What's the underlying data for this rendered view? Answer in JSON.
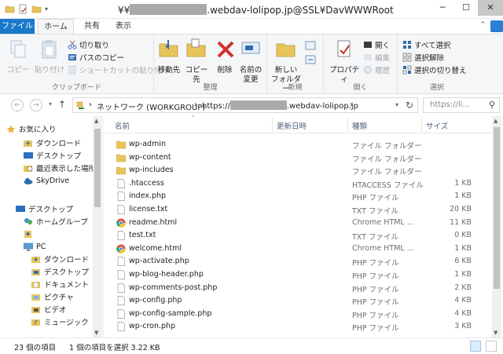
{
  "window": {
    "title_prefix": "¥¥",
    "title_suffix": ".webdav-lolipop.jp@SSL¥DavWWWRoot",
    "controls": {
      "minimize": "─",
      "maximize": "☐",
      "close": "✕"
    }
  },
  "ribbon_tabs": {
    "file": "ファイル",
    "home": "ホーム",
    "share": "共有",
    "view": "表示"
  },
  "ribbon": {
    "clipboard": {
      "label": "クリップボード",
      "copy": "コピー",
      "paste": "貼り付け",
      "cut": "切り取り",
      "copy_path": "パスのコピー",
      "paste_shortcut": "ショートカットの貼り付け"
    },
    "organize": {
      "label": "整理",
      "move_to": "移動先",
      "copy_to": "コピー先",
      "delete": "削除",
      "rename_line1": "名前の",
      "rename_line2": "変更"
    },
    "new": {
      "label": "新規",
      "new_folder_line1": "新しい",
      "new_folder_line2": "フォルダー"
    },
    "open": {
      "label": "開く",
      "properties": "プロパティ",
      "open": "開く",
      "edit": "編集",
      "history": "履歴"
    },
    "select": {
      "label": "選択",
      "select_all": "すべて選択",
      "select_none": "選択解除",
      "invert": "選択の切り替え"
    }
  },
  "address": {
    "network": "ネットワーク (WORKGROUP)",
    "url_prefix": "https://",
    "url_suffix": ".webdav-lolipop.jp",
    "separator": "›"
  },
  "search": {
    "placeholder": "https://li..."
  },
  "nav": {
    "favorites": "お気に入り",
    "downloads": "ダウンロード",
    "desktop": "デスクトップ",
    "recent": "最近表示した場所",
    "skydrive": "SkyDrive",
    "desktop_root": "デスクトップ",
    "homegroup": "ホームグループ",
    "pc": "PC",
    "pc_downloads": "ダウンロード",
    "pc_desktop": "デスクトップ",
    "documents": "ドキュメント",
    "pictures": "ピクチャ",
    "videos": "ビデオ",
    "music": "ミュージック"
  },
  "columns": {
    "name": "名前",
    "modified": "更新日時",
    "type": "種類",
    "size": "サイズ"
  },
  "files": [
    {
      "name": "wp-admin",
      "type": "ファイル フォルダー",
      "size": "",
      "icon": "folder-icon"
    },
    {
      "name": "wp-content",
      "type": "ファイル フォルダー",
      "size": "",
      "icon": "folder-icon"
    },
    {
      "name": "wp-includes",
      "type": "ファイル フォルダー",
      "size": "",
      "icon": "folder-icon"
    },
    {
      "name": ".htaccess",
      "type": "HTACCESS ファイル",
      "size": "1 KB",
      "icon": "file-icon"
    },
    {
      "name": "index.php",
      "type": "PHP ファイル",
      "size": "1 KB",
      "icon": "file-icon"
    },
    {
      "name": "license.txt",
      "type": "TXT ファイル",
      "size": "20 KB",
      "icon": "file-icon"
    },
    {
      "name": "readme.html",
      "type": "Chrome HTML ...",
      "size": "11 KB",
      "icon": "chrome-icon"
    },
    {
      "name": "test.txt",
      "type": "TXT ファイル",
      "size": "0 KB",
      "icon": "file-icon"
    },
    {
      "name": "welcome.html",
      "type": "Chrome HTML ...",
      "size": "1 KB",
      "icon": "chrome-icon"
    },
    {
      "name": "wp-activate.php",
      "type": "PHP ファイル",
      "size": "6 KB",
      "icon": "file-icon"
    },
    {
      "name": "wp-blog-header.php",
      "type": "PHP ファイル",
      "size": "1 KB",
      "icon": "file-icon"
    },
    {
      "name": "wp-comments-post.php",
      "type": "PHP ファイル",
      "size": "2 KB",
      "icon": "file-icon"
    },
    {
      "name": "wp-config.php",
      "type": "PHP ファイル",
      "size": "4 KB",
      "icon": "file-icon"
    },
    {
      "name": "wp-config-sample.php",
      "type": "PHP ファイル",
      "size": "4 KB",
      "icon": "file-icon"
    },
    {
      "name": "wp-cron.php",
      "type": "PHP ファイル",
      "size": "3 KB",
      "icon": "file-icon"
    }
  ],
  "status": {
    "item_count": "23 個の項目",
    "selection": "1 個の項目を選択  3.22 KB"
  },
  "colors": {
    "file_tab": "#1979ca",
    "folder": "#e8c45c",
    "header_text": "#4c607a"
  }
}
